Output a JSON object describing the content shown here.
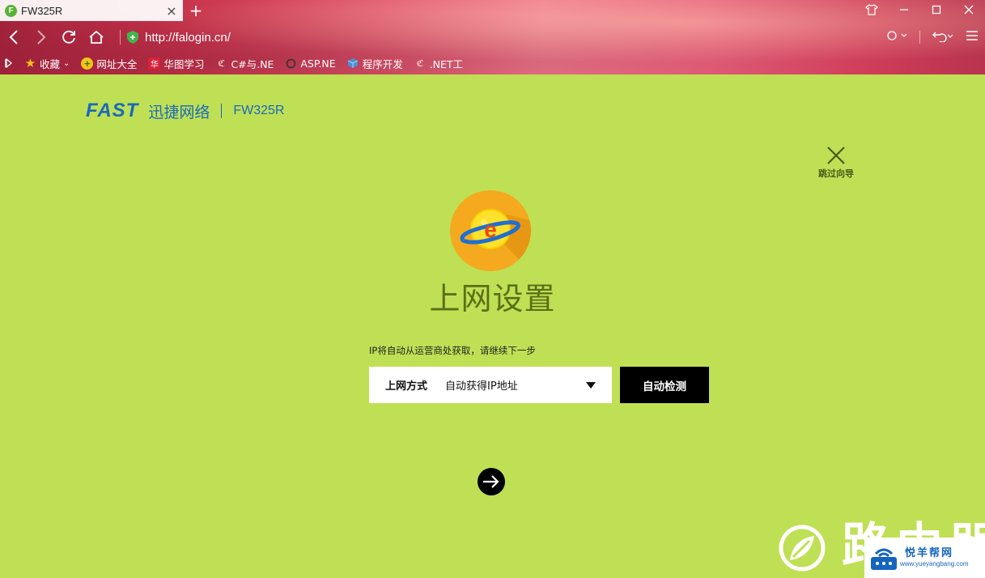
{
  "browser": {
    "tab_title": "FW325R",
    "tab_favicon_letter": "F",
    "url": "http://falogin.cn/",
    "bookmarks": [
      {
        "label": "收藏",
        "icon": "star-icon"
      },
      {
        "label": "网址大全",
        "icon": "plus-circle-icon"
      },
      {
        "label": "华图学习",
        "icon": "huatu-icon"
      },
      {
        "label": "C#与.NE",
        "icon": "csdn-icon"
      },
      {
        "label": "ASP.NE",
        "icon": "aspnet-icon"
      },
      {
        "label": "程序开发",
        "icon": "cube-icon"
      },
      {
        "label": ".NET工",
        "icon": "csdn-icon"
      }
    ]
  },
  "page": {
    "brand": "FAST",
    "brand_cn": "迅捷网络",
    "model": "FW325R",
    "skip_label": "跳过向导",
    "title": "上网设置",
    "hint": "IP将自动从运营商处获取，请继续下一步",
    "connection_label": "上网方式",
    "connection_value": "自动获得IP地址",
    "detect_button": "自动检测",
    "watermark_text": "路由器",
    "watermark_site_cn": "悦羊帮网",
    "watermark_site_url": "www.yueyangbang.com"
  },
  "colors": {
    "page_bg": "#bfe054",
    "brand_blue": "#1b69bb",
    "title_green": "#5b6f16",
    "button_black": "#000000",
    "globe_orange": "#f4a91e"
  }
}
